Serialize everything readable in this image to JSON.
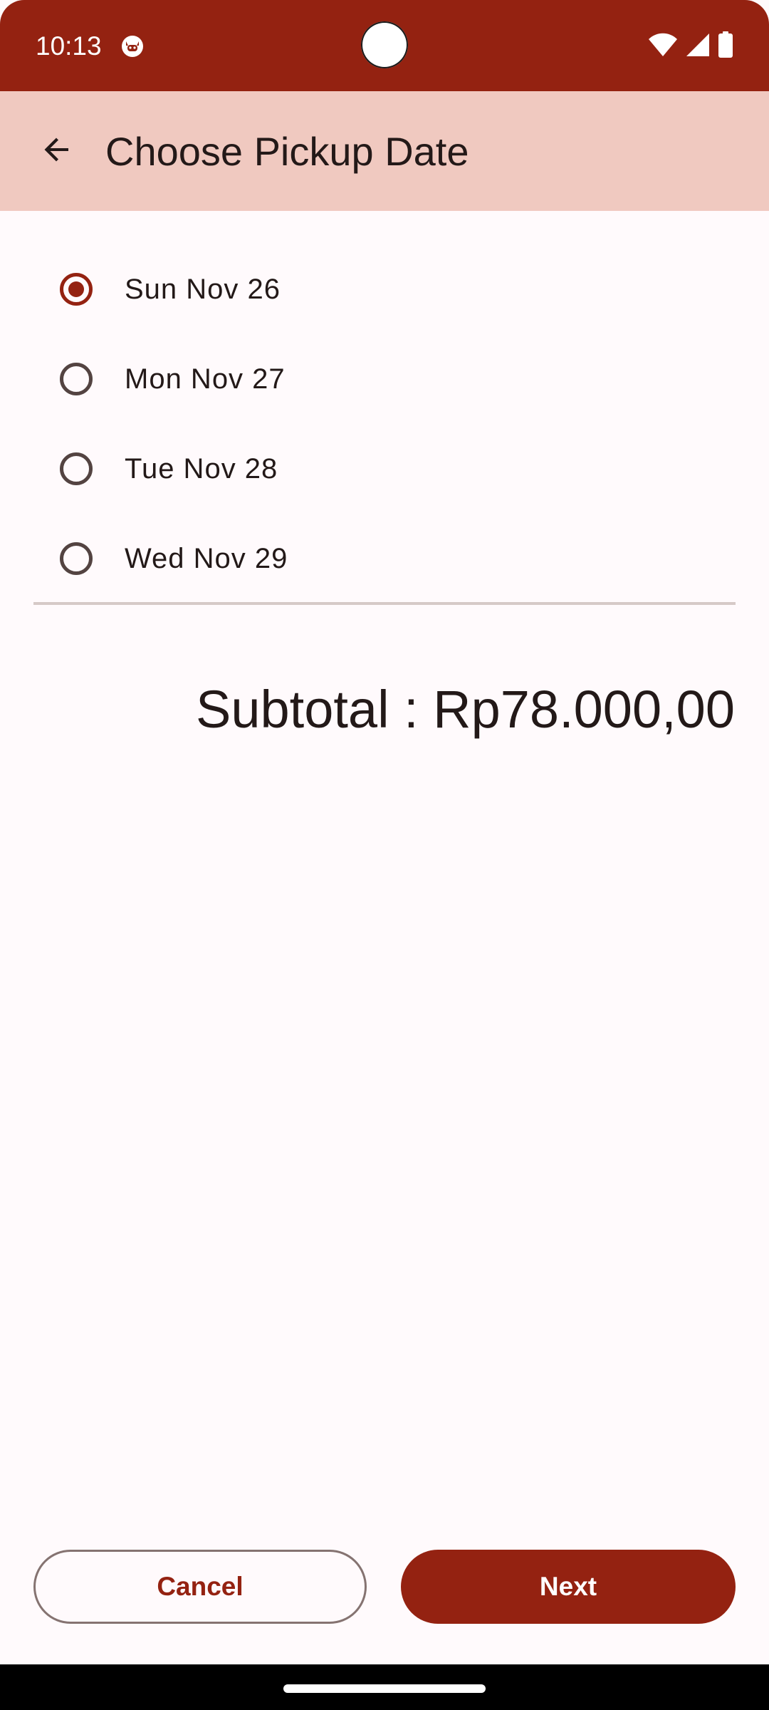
{
  "status_bar": {
    "time": "10:13",
    "icons": [
      "notification-cat-icon",
      "wifi-icon",
      "cellular-signal-icon",
      "battery-icon"
    ]
  },
  "app_bar": {
    "title": "Choose Pickup Date",
    "back_icon": "arrow-back-icon"
  },
  "pickup_dates": {
    "options": [
      {
        "label": "Sun Nov 26",
        "selected": true
      },
      {
        "label": "Mon Nov 27",
        "selected": false
      },
      {
        "label": "Tue Nov 28",
        "selected": false
      },
      {
        "label": "Wed Nov 29",
        "selected": false
      }
    ]
  },
  "subtotal": {
    "text": "Subtotal : Rp78.000,00"
  },
  "actions": {
    "cancel_label": "Cancel",
    "next_label": "Next"
  },
  "colors": {
    "primary": "#942211",
    "app_bar_bg": "#F0C9C0",
    "background": "#FFFAFC",
    "on_surface": "#231918"
  }
}
